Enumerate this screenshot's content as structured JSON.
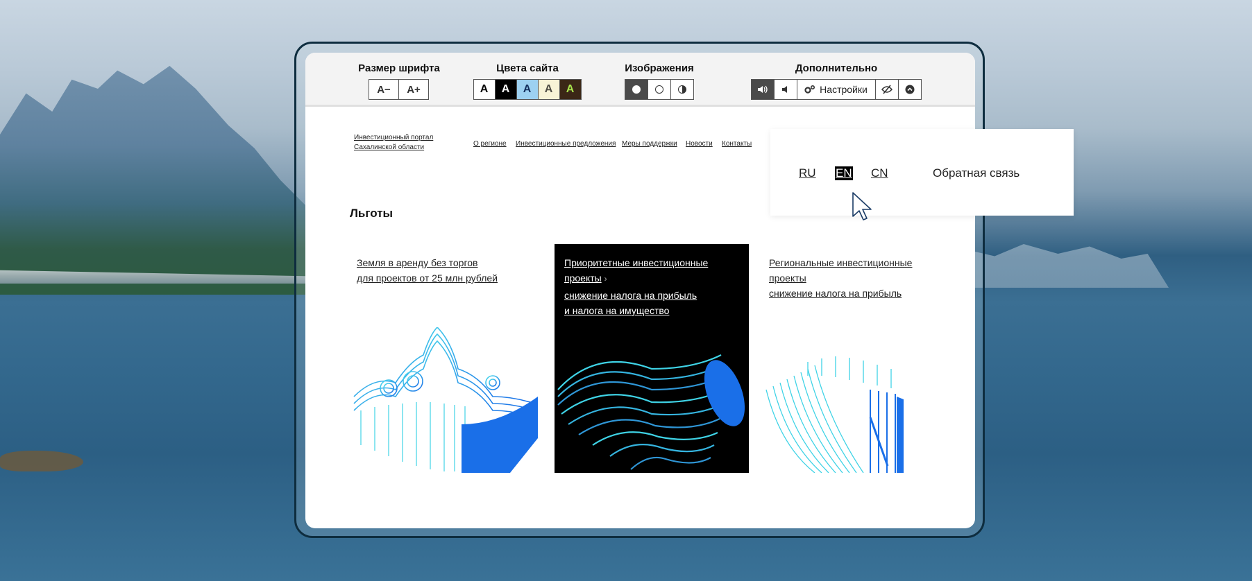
{
  "a11y": {
    "font_size": {
      "title": "Размер шрифта",
      "decrease": "A−",
      "increase": "A+"
    },
    "colors": {
      "title": "Цвета сайта",
      "swatches": [
        {
          "label": "A",
          "bg": "#ffffff",
          "fg": "#000000"
        },
        {
          "label": "A",
          "bg": "#000000",
          "fg": "#ffffff"
        },
        {
          "label": "A",
          "bg": "#9dd1f1",
          "fg": "#14305e"
        },
        {
          "label": "A",
          "bg": "#f7f3d6",
          "fg": "#4d4b43"
        },
        {
          "label": "A",
          "bg": "#3b2716",
          "fg": "#a9e44d"
        }
      ]
    },
    "images": {
      "title": "Изображения"
    },
    "extra": {
      "title": "Дополнительно",
      "settings_label": "Настройки"
    }
  },
  "header": {
    "logo_line1": "Инвестиционный портал",
    "logo_line2": "Сахалинской области",
    "nav": [
      "О регионе",
      "Инвестиционные предложения",
      "Меры поддержки",
      "Новости",
      "Контакты"
    ]
  },
  "page": {
    "title": "Льготы"
  },
  "cards": [
    {
      "line1": "Земля в аренду без торгов",
      "line2": "для проектов от 25 млн рублей"
    },
    {
      "line1": "Приоритетные инвестиционные",
      "line2": "проекты",
      "line3": "снижение налога на прибыль",
      "line4": "и налога на имущество"
    },
    {
      "line1": "Региональные инвестиционные",
      "line2": "проекты",
      "line3": "снижение налога на прибыль"
    }
  ],
  "lang_panel": {
    "ru": "RU",
    "en": "EN",
    "cn": "CN",
    "feedback": "Обратная связь"
  },
  "colors": {
    "accent_blue": "#1a6fe8",
    "cyan": "#3fd3e6",
    "dark": "#000000"
  }
}
